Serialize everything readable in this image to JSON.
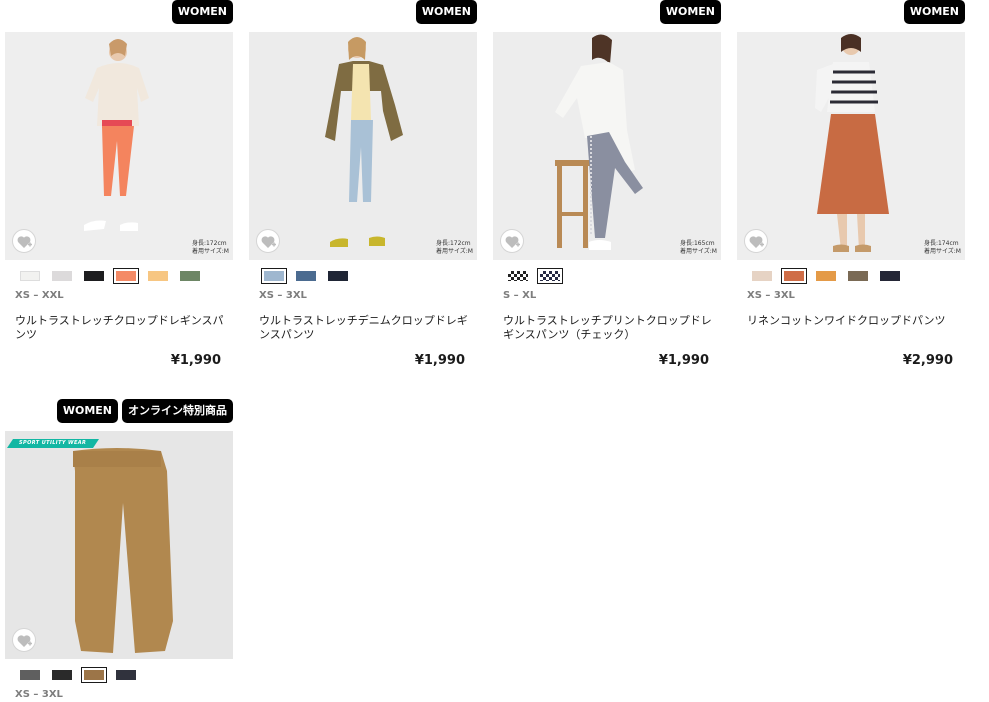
{
  "products": [
    {
      "badges": [
        "WOMEN"
      ],
      "size_note_1": "身長:172cm",
      "size_note_2": "着用サイズ:M",
      "sizes": "XS – XXL",
      "name": "ウルトラストレッチクロップドレギンスパンツ",
      "price": "¥1,990",
      "swatch_colors": [
        "#f2f2f0",
        "#dcdadb",
        "#1d1d1f",
        "#f48a66",
        "#f7c682",
        "#6d8665"
      ],
      "selected_swatch": 3,
      "icon": "heart-plus-icon"
    },
    {
      "badges": [
        "WOMEN"
      ],
      "size_note_1": "身長:172cm",
      "size_note_2": "着用サイズ:M",
      "sizes": "XS – 3XL",
      "name": "ウルトラストレッチデニムクロップドレギンスパンツ",
      "price": "¥1,990",
      "swatch_colors": [
        "#9fb7cf",
        "#4b6b90",
        "#1f2535"
      ],
      "selected_swatch": 0,
      "icon": "heart-plus-icon"
    },
    {
      "badges": [
        "WOMEN"
      ],
      "size_note_1": "身長:165cm",
      "size_note_2": "着用サイズ:M",
      "sizes": "S – XL",
      "name": "ウルトラストレッチプリントクロップドレギンスパンツ（チェック）",
      "price": "¥1,990",
      "swatch_colors": [
        "#3a3a3a",
        "#262a44"
      ],
      "selected_swatch": 1,
      "icon": "heart-plus-icon"
    },
    {
      "badges": [
        "WOMEN"
      ],
      "size_note_1": "身長:174cm",
      "size_note_2": "着用サイズ:M",
      "sizes": "XS – 3XL",
      "name": "リネンコットンワイドクロップドパンツ",
      "price": "¥2,990",
      "swatch_colors": [
        "#e6d3c4",
        "#cf6d47",
        "#e49a47",
        "#7a6a55",
        "#242636"
      ],
      "selected_swatch": 1,
      "icon": "heart-plus-icon"
    },
    {
      "badges": [
        "WOMEN",
        "オンライン特別商品"
      ],
      "sizes": "XS – 3XL",
      "sport_tag": "SPORT UTILITY WEAR",
      "swatch_colors": [
        "#5f5f5f",
        "#2a2a2a",
        "#9c7548",
        "#30323d"
      ],
      "selected_swatch": 2,
      "icon": "heart-plus-icon"
    }
  ]
}
